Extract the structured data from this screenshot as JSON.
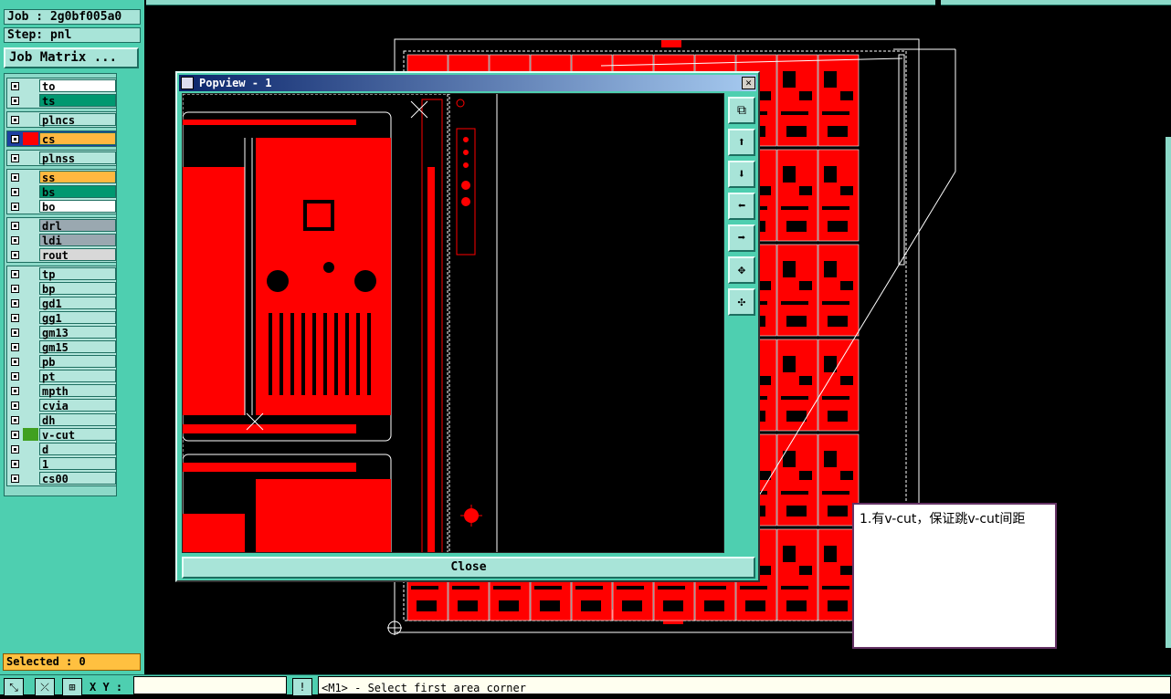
{
  "header": {
    "job": "Job : 2g0bf005a0",
    "step": "Step: pnl",
    "job_matrix": "Job Matrix ..."
  },
  "layer_groups": [
    {
      "layers": [
        {
          "name": "to",
          "color": "#ffffff",
          "swatch": ""
        },
        {
          "name": "ts",
          "color": "#009870",
          "swatch": ""
        }
      ]
    },
    {
      "layers": [
        {
          "name": "plncs",
          "color": "#b4e6dc",
          "swatch": ""
        }
      ]
    },
    {
      "layers": [
        {
          "name": "cs",
          "color": "#ffb840",
          "swatch": "#ff0000",
          "active": true
        }
      ]
    },
    {
      "layers": [
        {
          "name": "plnss",
          "color": "#b4e6dc",
          "swatch": ""
        }
      ]
    },
    {
      "layers": [
        {
          "name": "ss",
          "color": "#ffb840",
          "swatch": ""
        },
        {
          "name": "bs",
          "color": "#009870",
          "swatch": ""
        },
        {
          "name": "bo",
          "color": "#ffffff",
          "swatch": ""
        }
      ]
    },
    {
      "layers": [
        {
          "name": "drl",
          "color": "#9aa8b0",
          "swatch": ""
        },
        {
          "name": "ldi",
          "color": "#9aa8b0",
          "swatch": ""
        },
        {
          "name": "rout",
          "color": "#d8d8d8",
          "swatch": ""
        }
      ]
    },
    {
      "layers": [
        {
          "name": "tp",
          "color": "#b4e6dc",
          "swatch": ""
        },
        {
          "name": "bp",
          "color": "#b4e6dc",
          "swatch": ""
        },
        {
          "name": "gd1",
          "color": "#b4e6dc",
          "swatch": ""
        },
        {
          "name": "gg1",
          "color": "#b4e6dc",
          "swatch": ""
        },
        {
          "name": "gm13",
          "color": "#b4e6dc",
          "swatch": ""
        },
        {
          "name": "gm15",
          "color": "#b4e6dc",
          "swatch": ""
        },
        {
          "name": "pb",
          "color": "#b4e6dc",
          "swatch": ""
        },
        {
          "name": "pt",
          "color": "#b4e6dc",
          "swatch": ""
        },
        {
          "name": "mpth",
          "color": "#b4e6dc",
          "swatch": ""
        },
        {
          "name": "cvia",
          "color": "#b4e6dc",
          "swatch": ""
        },
        {
          "name": "dh",
          "color": "#b4e6dc",
          "swatch": ""
        },
        {
          "name": "v-cut",
          "color": "#b4e6dc",
          "swatch": "#40a020"
        },
        {
          "name": "d",
          "color": "#b4e6dc",
          "swatch": ""
        },
        {
          "name": "1",
          "color": "#b4e6dc",
          "swatch": ""
        },
        {
          "name": "cs00",
          "color": "#b4e6dc",
          "swatch": ""
        }
      ]
    }
  ],
  "status": {
    "selected": "Selected : 0",
    "xy_label": "X Y :",
    "xy_value": "",
    "message": "<M1> - Select first area corner"
  },
  "popview": {
    "title": "Popview - 1",
    "close_label": "Close",
    "close_x": "✕"
  },
  "note": {
    "text": "1.有v-cut，保证跳v-cut间距"
  },
  "colors": {
    "pcb_red": "#ff0000",
    "panel_teal": "#4ecfb0"
  }
}
